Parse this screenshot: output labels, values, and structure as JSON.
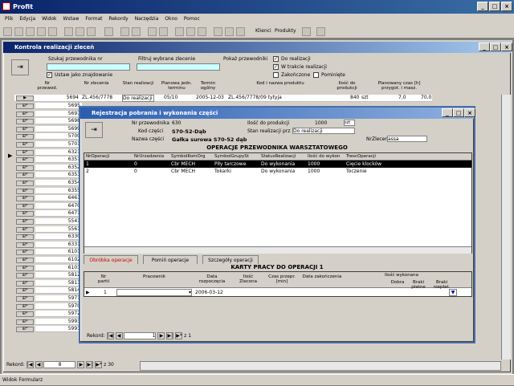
{
  "app": {
    "title": "Profit"
  },
  "menu": [
    "Plik",
    "Edycja",
    "Widok",
    "Wstaw",
    "Format",
    "Rekordy",
    "Narzędzia",
    "Okno",
    "Pomoc"
  ],
  "toolbar": {
    "klienci": "Klienci",
    "produkty": "Produkty"
  },
  "status": {
    "text": "Widok Formularz"
  },
  "kontrola": {
    "title": "Kontrola realizacji zleceń",
    "szukaj_label": "Szukaj przewodnika nr",
    "filtruj_label": "Filtruj wybrane zlecenie",
    "pokaz_label": "Pokaż przewodniki",
    "opt1": "Do realizacji",
    "opt2": "W trakcie realizacji",
    "opt3": "Zakończone",
    "opt4": "Pominięte",
    "ustaw_label": "Ustaw jako znajdowanie",
    "headers": [
      "Nr przewod.",
      "Nr zlecenia",
      "Stan realizacji",
      "Planowa jedn. terminu",
      "Termin ogólny",
      "Kod i nazwa produktu",
      "Ilość do produkcji",
      "Planowany czas [h] przygot. i masz."
    ],
    "row1": {
      "id": "5694",
      "zlec": "ZL.456/7778",
      "stan": "Do realizacji",
      "plan": "05/10",
      "termin": "2005-12-03",
      "kod": "ZL.456/7778/09 tytyja",
      "ilosc": "840",
      "jm": "szt",
      "t1": "7,0",
      "t2": "70,0"
    },
    "rows": [
      "5695",
      "5697",
      "5698",
      "5699",
      "5700",
      "5701",
      "6321",
      "6351",
      "6352",
      "6353",
      "6354",
      "6355",
      "6461",
      "6470",
      "6471",
      "5541",
      "5561",
      "6330",
      "6331",
      "6101",
      "6102",
      "6103",
      "5812",
      "5813",
      "5814",
      "5971",
      "5970",
      "5972",
      "5993",
      "5993"
    ],
    "nav": {
      "label": "Rekord:",
      "current": "8",
      "total": "z 30"
    }
  },
  "rejestracja": {
    "title": "Rejestracja pobrania i wykonania części",
    "nr_label": "Nr przewodnika",
    "nr_value": "630",
    "ilosc_label": "Ilość do produkcji",
    "ilosc_value": "1000",
    "ilosc_unit": "szt",
    "kod_label": "Kod części",
    "kod_value": "S70-52-Dąb",
    "stan_label": "Stan realizacji prz",
    "stan_value": "Do realizacji",
    "nazwa_label": "Nazwa części",
    "nazwa_value": "Gałka surowa S70-52 dąb",
    "nrzl_label": "NrZlecenia",
    "nrzl_value": "assa",
    "op_title": "OPERACJE PRZEWODNIKA WARSZTATOWEGO",
    "op_headers": [
      "NrOperacji",
      "NrUrzadzenia",
      "SymbolKomOrg",
      "SymbolGrupySt",
      "StatusRealizacji",
      "Ilość do wykon",
      "TrescOperacji"
    ],
    "op_rows": [
      [
        "1",
        "0",
        "Cbr MECH",
        "Piły tarczowe",
        "Do wykonania",
        "1000",
        "Cięcie klocków"
      ],
      [
        "2",
        "0",
        "Cbr MECH",
        "Tokarki",
        "Do wykonania",
        "1000",
        "Toczenie"
      ]
    ],
    "tabs": [
      "Obróbka operacje",
      "Pomiń operacje",
      "Szczegóły operacji"
    ],
    "karty_title": "KARTY PRACY DO OPERACJI 1",
    "karty_headers": [
      "Nr partii",
      "Pracownik",
      "Data rozpoczęcia",
      "Ilość Zlecona",
      "Czas przepr. [min]",
      "Data zakończenia",
      "Ilość wykonana",
      "Dobra",
      "Braki płatne",
      "Braki niepłat."
    ],
    "karty_row": {
      "nr": "1",
      "data": "2006-03-12"
    },
    "nav": {
      "label": "Rekord:",
      "current": "1",
      "total": "z 1"
    }
  }
}
